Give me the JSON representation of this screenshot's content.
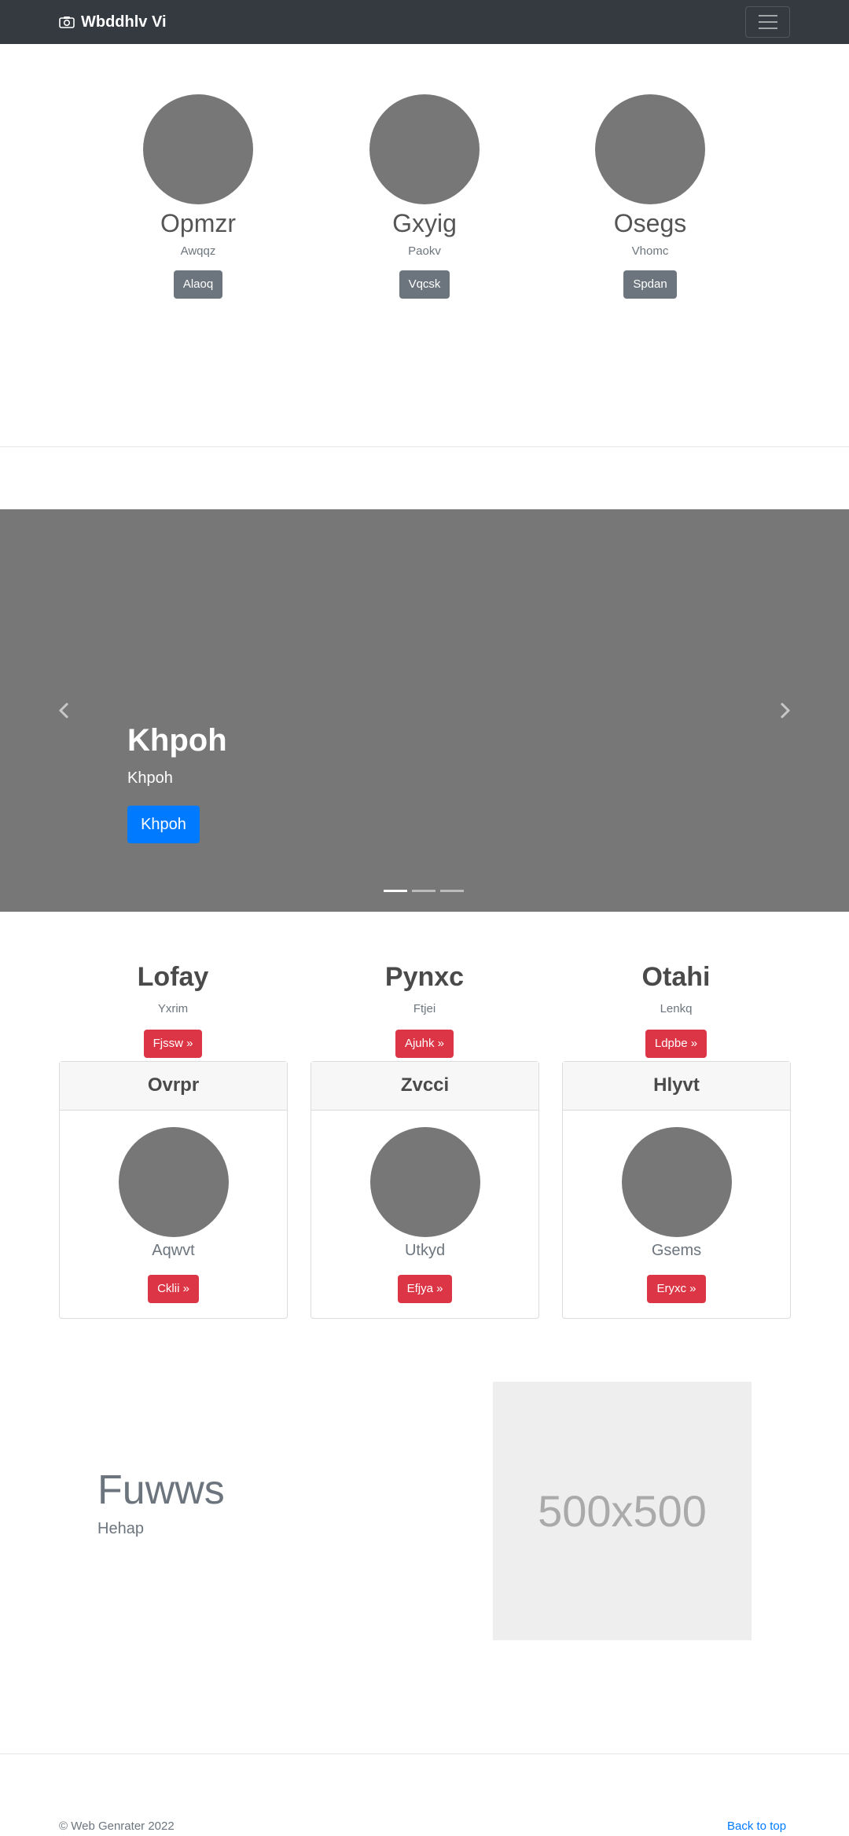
{
  "navbar": {
    "brand": "Wbddhlv Vi",
    "brand_icon": "camera-icon",
    "toggler_icon": "hamburger-icon"
  },
  "team": [
    {
      "name": "Opmzr",
      "subtitle": "Awqqz",
      "button": "Alaoq"
    },
    {
      "name": "Gxyig",
      "subtitle": "Paokv",
      "button": "Vqcsk"
    },
    {
      "name": "Osegs",
      "subtitle": "Vhomc",
      "button": "Spdan"
    }
  ],
  "carousel": {
    "title": "Khpoh",
    "subtitle": "Khpoh",
    "button": "Khpoh",
    "slide_count": 3,
    "active_slide": 1
  },
  "features": [
    {
      "title": "Lofay",
      "subtitle": "Yxrim",
      "button": "Fjssw »"
    },
    {
      "title": "Pynxc",
      "subtitle": "Ftjei",
      "button": "Ajuhk »"
    },
    {
      "title": "Otahi",
      "subtitle": "Lenkq",
      "button": "Ldpbe »"
    }
  ],
  "cards": [
    {
      "header": "Ovrpr",
      "text": "Aqwvt",
      "button": "Cklii »"
    },
    {
      "header": "Zvcci",
      "text": "Utkyd",
      "button": "Efjya »"
    },
    {
      "header": "Hlyvt",
      "text": "Gsems",
      "button": "Eryxc »"
    }
  ],
  "feature": {
    "heading": "Fuwws",
    "lead": "Hehap",
    "image_label": "500x500"
  },
  "footer": {
    "copyright": "© Web Genrater 2022",
    "back_to_top": "Back to top"
  },
  "colors": {
    "navbar": "#343a40",
    "placeholder_gray": "#777777",
    "primary": "#007bff",
    "danger": "#dc3545",
    "secondary": "#6c757d"
  }
}
